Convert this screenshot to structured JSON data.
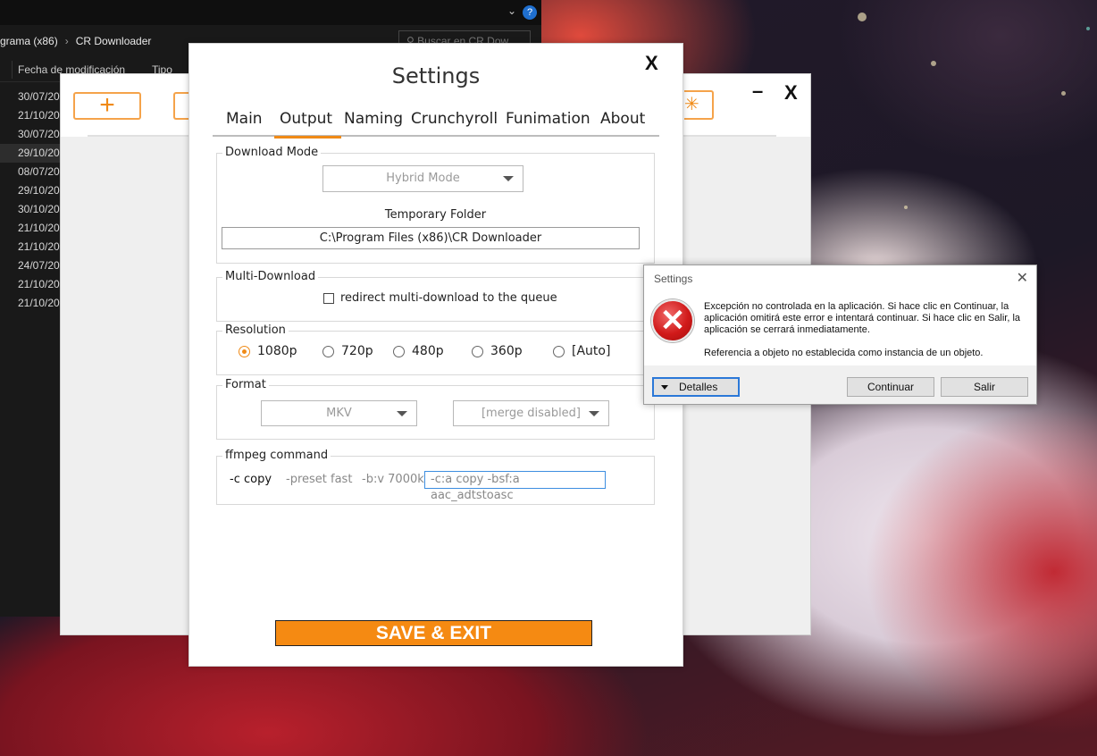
{
  "explorer": {
    "breadcrumb_part1": "grama (x86)",
    "breadcrumb_part2": "CR Downloader",
    "search_placeholder": "Buscar en CR Dow",
    "col_date": "Fecha de modificación",
    "col_type": "Tipo",
    "rows": [
      "30/07/20",
      "21/10/20",
      "30/07/20",
      "29/10/20",
      "08/07/20",
      "29/10/20",
      "30/10/20",
      "21/10/20",
      "21/10/20",
      "24/07/20",
      "21/10/20",
      "21/10/20"
    ]
  },
  "cr_main": {
    "add_label": "+",
    "minimize_label": "–",
    "close_label": "X"
  },
  "settings": {
    "title": "Settings",
    "close_label": "X",
    "tabs": [
      "Main",
      "Output",
      "Naming",
      "Crunchyroll",
      "Funimation",
      "About"
    ],
    "active_tab": "Output",
    "download_mode": {
      "label": "Download Mode",
      "selected": "Hybrid Mode",
      "temp_folder_label": "Temporary Folder",
      "temp_folder_value": "C:\\Program Files (x86)\\CR Downloader"
    },
    "multi_download": {
      "label": "Multi-Download",
      "checkbox_label": "redirect multi-download to the queue",
      "checked": false
    },
    "resolution": {
      "label": "Resolution",
      "options": [
        "1080p",
        "720p",
        "480p",
        "360p",
        "[Auto]"
      ],
      "selected": "1080p"
    },
    "format": {
      "label": "Format",
      "container": "MKV",
      "merge": "[merge disabled]"
    },
    "ffmpeg": {
      "label": "ffmpeg command",
      "parts": [
        "-c copy",
        "-preset fast",
        "-b:v 7000k"
      ],
      "input_value": "-c:a copy -bsf:a aac_adtstoasc"
    },
    "save_label": "SAVE & EXIT",
    "accent_color": "#f08a16"
  },
  "error_dialog": {
    "title": "Settings",
    "message": "Excepción no controlada en la aplicación. Si hace clic en Continuar, la aplicación omitirá este error e intentará continuar. Si hace clic en Salir, la aplicación se cerrará inmediatamente.",
    "reference": "Referencia a objeto no establecida como instancia de un objeto.",
    "details_label": "Detalles",
    "continue_label": "Continuar",
    "exit_label": "Salir"
  }
}
